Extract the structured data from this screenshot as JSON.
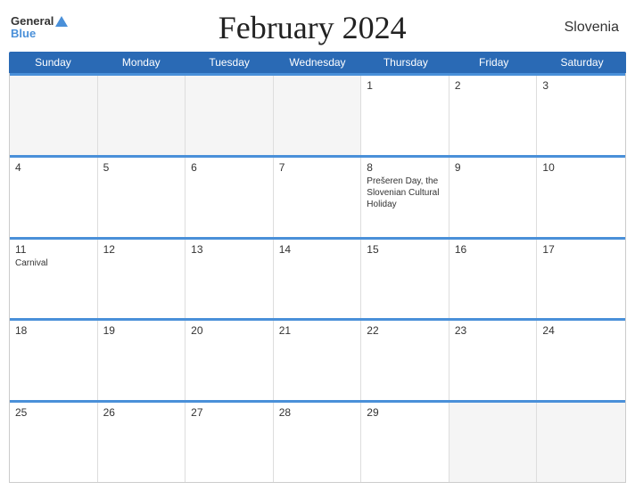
{
  "header": {
    "logo_general": "General",
    "logo_blue": "Blue",
    "title": "February 2024",
    "country": "Slovenia"
  },
  "days_of_week": [
    "Sunday",
    "Monday",
    "Tuesday",
    "Wednesday",
    "Thursday",
    "Friday",
    "Saturday"
  ],
  "weeks": [
    [
      {
        "day": "",
        "empty": true
      },
      {
        "day": "",
        "empty": true
      },
      {
        "day": "",
        "empty": true
      },
      {
        "day": "",
        "empty": true
      },
      {
        "day": "1",
        "events": []
      },
      {
        "day": "2",
        "events": []
      },
      {
        "day": "3",
        "events": []
      }
    ],
    [
      {
        "day": "4",
        "events": []
      },
      {
        "day": "5",
        "events": []
      },
      {
        "day": "6",
        "events": []
      },
      {
        "day": "7",
        "events": []
      },
      {
        "day": "8",
        "events": [
          "Prešeren Day, the Slovenian Cultural Holiday"
        ]
      },
      {
        "day": "9",
        "events": []
      },
      {
        "day": "10",
        "events": []
      }
    ],
    [
      {
        "day": "11",
        "events": [
          "Carnival"
        ]
      },
      {
        "day": "12",
        "events": []
      },
      {
        "day": "13",
        "events": []
      },
      {
        "day": "14",
        "events": []
      },
      {
        "day": "15",
        "events": []
      },
      {
        "day": "16",
        "events": []
      },
      {
        "day": "17",
        "events": []
      }
    ],
    [
      {
        "day": "18",
        "events": []
      },
      {
        "day": "19",
        "events": []
      },
      {
        "day": "20",
        "events": []
      },
      {
        "day": "21",
        "events": []
      },
      {
        "day": "22",
        "events": []
      },
      {
        "day": "23",
        "events": []
      },
      {
        "day": "24",
        "events": []
      }
    ],
    [
      {
        "day": "25",
        "events": []
      },
      {
        "day": "26",
        "events": []
      },
      {
        "day": "27",
        "events": []
      },
      {
        "day": "28",
        "events": []
      },
      {
        "day": "29",
        "events": []
      },
      {
        "day": "",
        "empty": true
      },
      {
        "day": "",
        "empty": true
      }
    ]
  ]
}
